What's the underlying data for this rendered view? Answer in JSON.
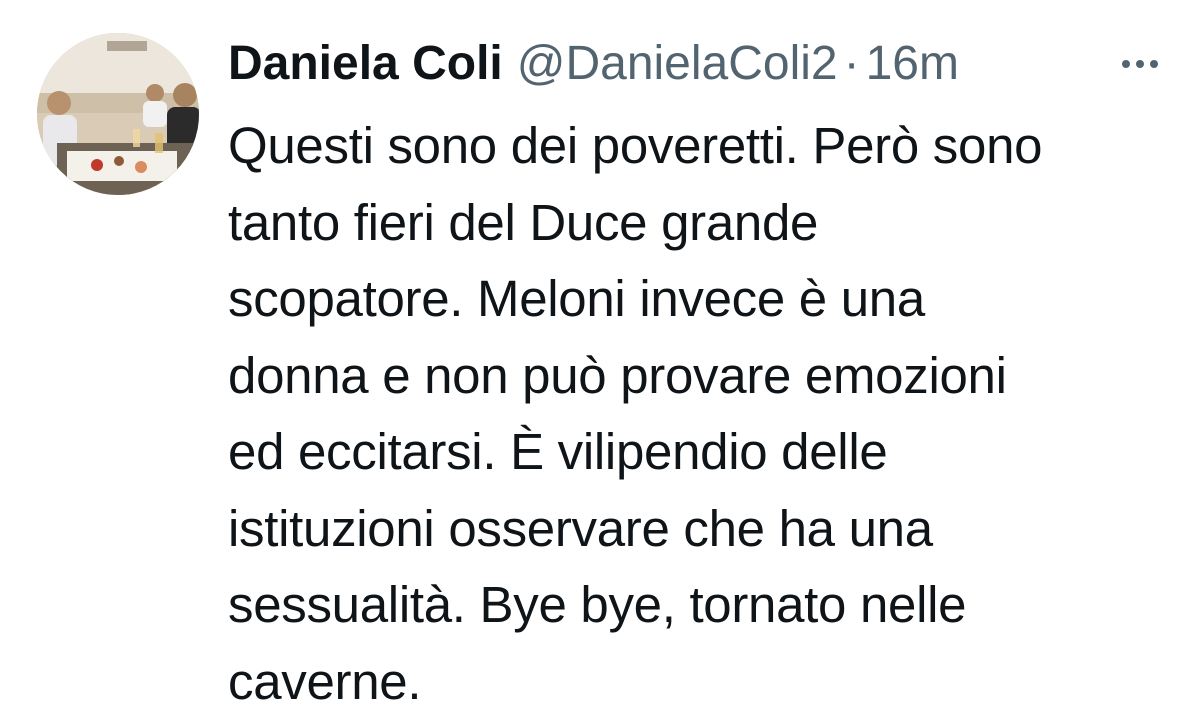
{
  "tweet": {
    "author": {
      "display_name": "Daniela Coli",
      "handle": "@DanielaColi2",
      "avatar_icon": "profile-photo-avatar"
    },
    "separator": "·",
    "timestamp": "16m",
    "more_icon": "more-options-icon",
    "text_lines": [
      "Questi sono dei poveretti. Però sono",
      "tanto fieri del Duce grande",
      "scopatore. Meloni invece è una",
      "donna e non può provare emozioni",
      "ed eccitarsi. È vilipendio delle",
      "istituzioni osservare che ha una",
      "sessualità. Bye bye, tornato nelle",
      "caverne."
    ]
  },
  "colors": {
    "text_primary": "#0f1419",
    "text_secondary": "#536471",
    "background": "#ffffff"
  }
}
